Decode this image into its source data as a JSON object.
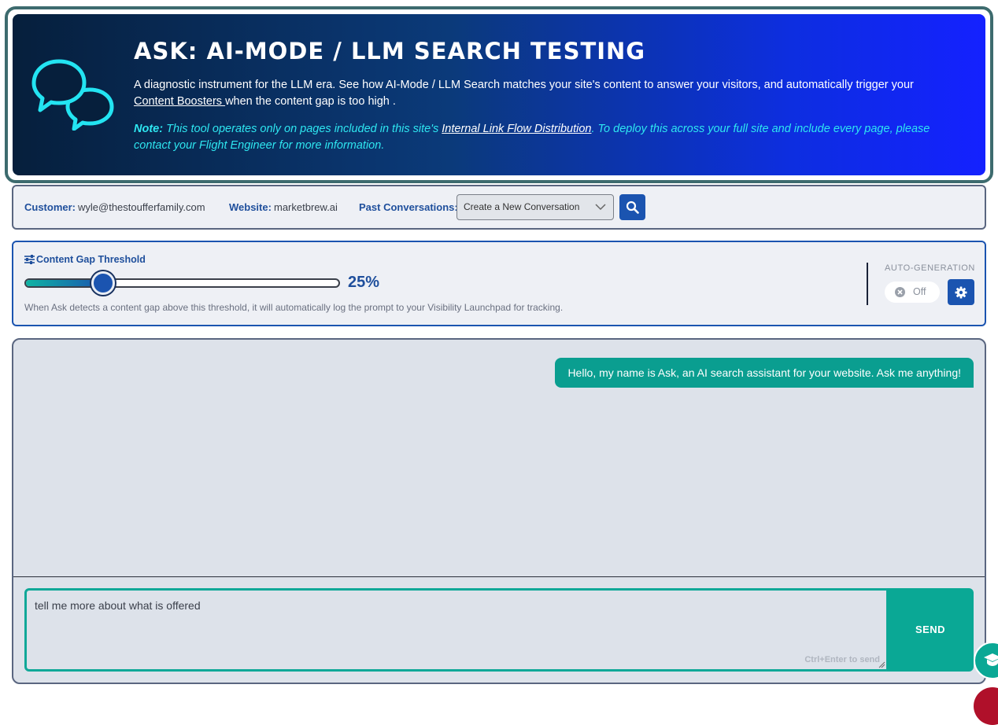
{
  "banner": {
    "title": "Ask: AI-Mode / LLM Search Testing",
    "desc_pre": "A diagnostic instrument for the LLM era. See how AI-Mode / LLM Search matches your site's content to answer your visitors, and automatically trigger your ",
    "desc_link": "Content Boosters ",
    "desc_post": "when the content gap is too high .",
    "note_label": "Note:",
    "note_pre": " This tool operates only on pages included in this site's ",
    "note_link": "Internal Link Flow Distribution",
    "note_post": ". To deploy this across your full site and include every page, please contact your Flight Engineer for more information."
  },
  "customer_bar": {
    "customer_label": "Customer:",
    "customer_value": "wyle@thestoufferfamily.com",
    "website_label": "Website:",
    "website_value": "marketbrew.ai",
    "past_label": "Past Conversations:",
    "conversation_select": "Create a New Conversation"
  },
  "threshold": {
    "title": "Content Gap Threshold",
    "value": 25,
    "value_label": "25%",
    "help": "When Ask detects a content gap above this threshold, it will automatically log the prompt to your Visibility Launchpad for tracking.",
    "auto_label": "AUTO-GENERATION",
    "auto_state": "Off"
  },
  "chat": {
    "assistant_message": "Hello, my name is Ask, an AI search assistant for your website. Ask me anything!",
    "input_value": "tell me more about what is offered",
    "hint": "Ctrl+Enter to send",
    "send_label": "SEND"
  },
  "colors": {
    "accent_blue": "#1b54b0",
    "accent_teal": "#0aa895",
    "note_cyan": "#2ee6f0"
  }
}
